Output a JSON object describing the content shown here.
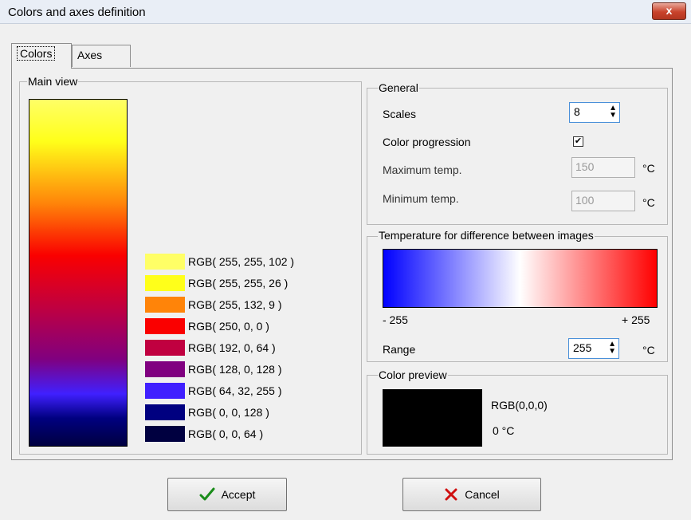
{
  "window": {
    "title": "Colors and axes definition",
    "close_glyph": "x"
  },
  "tabs": [
    {
      "label": "Colors"
    },
    {
      "label": "Axes"
    }
  ],
  "main_view": {
    "title": "Main view",
    "palette": [
      {
        "label": "RGB( 255, 255, 102 )",
        "color": "#ffff66"
      },
      {
        "label": "RGB( 255, 255, 26 )",
        "color": "#ffff1a"
      },
      {
        "label": "RGB( 255, 132, 9 )",
        "color": "#ff8409"
      },
      {
        "label": "RGB( 250, 0, 0 )",
        "color": "#fa0000"
      },
      {
        "label": "RGB( 192, 0, 64 )",
        "color": "#c00040"
      },
      {
        "label": "RGB( 128, 0, 128 )",
        "color": "#800080"
      },
      {
        "label": "RGB( 64, 32, 255 )",
        "color": "#4020ff"
      },
      {
        "label": "RGB( 0, 0, 128 )",
        "color": "#000080"
      },
      {
        "label": "RGB( 0, 0, 64 )",
        "color": "#000040"
      }
    ]
  },
  "general": {
    "title": "General",
    "scales_label": "Scales",
    "scales_value": "8",
    "color_progression_label": "Color progression",
    "color_progression_checked": true,
    "max_temp_label": "Maximum temp.",
    "max_temp_value": "150",
    "min_temp_label": "Minimum temp.",
    "min_temp_value": "100",
    "unit": "°C"
  },
  "difference": {
    "title": "Temperature for difference between images",
    "min_label": "- 255",
    "max_label": "+ 255",
    "range_label": "Range",
    "range_value": "255",
    "unit": "°C",
    "gradient": [
      "#0000ff",
      "#ffffff",
      "#ff0000"
    ]
  },
  "preview": {
    "title": "Color preview",
    "rgb_text": "RGB(0,0,0)",
    "temp_text": "0 °C",
    "color": "#000000"
  },
  "buttons": {
    "accept": "Accept",
    "cancel": "Cancel"
  },
  "colors": {
    "accept_check": "#1a8c1a",
    "cancel_x": "#d01010",
    "focus_border": "#4a90d9"
  }
}
